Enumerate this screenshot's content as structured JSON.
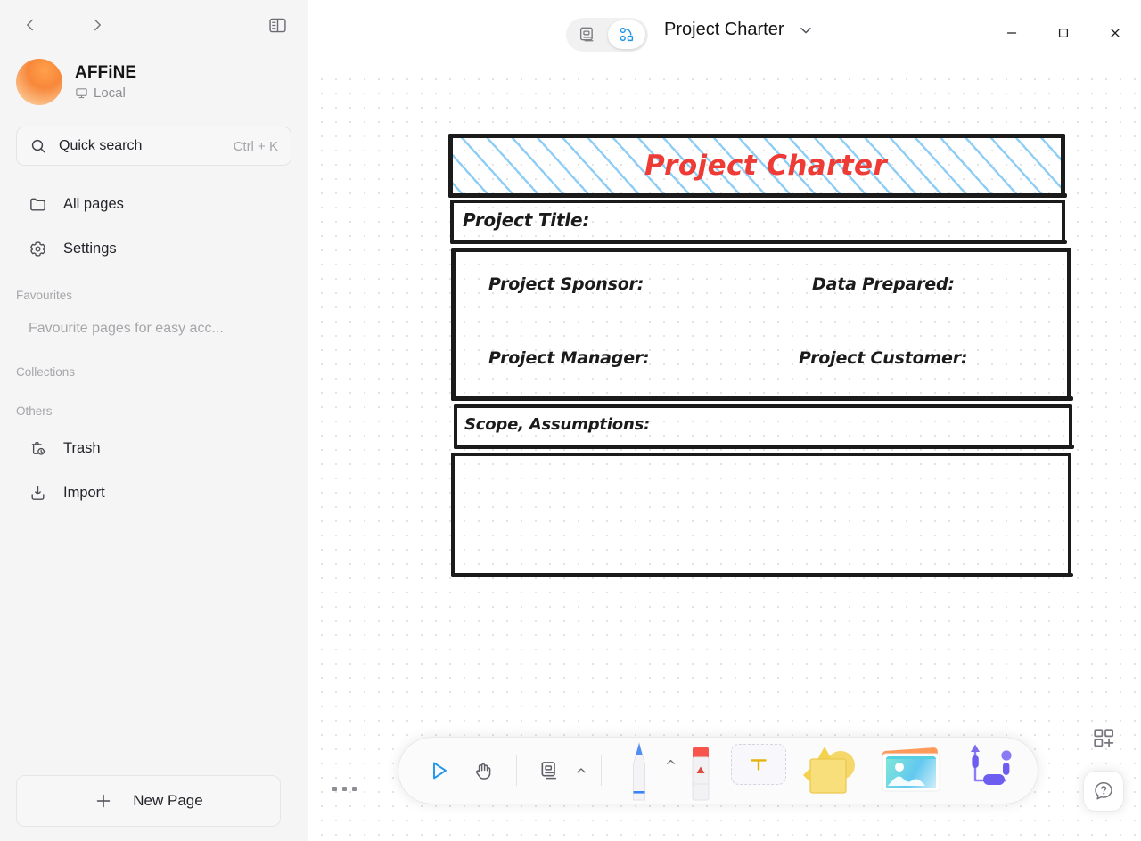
{
  "sidebar": {
    "nav": {
      "back_icon": "chevron-left-icon",
      "forward_icon": "chevron-right-icon",
      "toggle_icon": "sidebar-toggle-icon"
    },
    "workspace": {
      "name": "AFFiNE",
      "sub": "Local",
      "sub_icon": "local-desktop-icon"
    },
    "search": {
      "label": "Quick search",
      "shortcut": "Ctrl + K",
      "icon": "search-icon"
    },
    "items": [
      {
        "label": "All pages",
        "icon": "folder-icon"
      },
      {
        "label": "Settings",
        "icon": "gear-icon"
      }
    ],
    "sections": [
      {
        "label": "Favourites",
        "empty": "Favourite pages for easy acc..."
      },
      {
        "label": "Collections",
        "empty": ""
      },
      {
        "label": "Others",
        "empty": ""
      }
    ],
    "others": [
      {
        "label": "Trash",
        "icon": "trash-icon"
      },
      {
        "label": "Import",
        "icon": "import-icon"
      }
    ],
    "new_page": {
      "label": "New Page",
      "icon": "plus-icon"
    }
  },
  "header": {
    "mode": {
      "page_label": "page-mode",
      "edgeless_label": "edgeless-mode",
      "active": "edgeless"
    },
    "doc_title": "Project Charter",
    "title_chevron": "chevron-down-icon",
    "more_icon": "more-vertical-icon",
    "window": {
      "minimize": "minimize-icon",
      "maximize": "maximize-icon",
      "close": "close-icon"
    }
  },
  "canvas": {
    "handle_icon": "drag-dots-icon",
    "board": {
      "title": "Project Charter",
      "fields": [
        "Project Title:",
        "Project Sponsor:",
        "Data Prepared:",
        "Project Manager:",
        "Project Customer:",
        "Scope, Assumptions:"
      ]
    }
  },
  "toolbar": {
    "tools": [
      {
        "name": "select-tool",
        "icon": "cursor-arrow-icon"
      },
      {
        "name": "pan-tool",
        "icon": "hand-icon"
      },
      {
        "name": "note-tool",
        "icon": "note-icon"
      },
      {
        "name": "pen-tool",
        "icon": "pen-icon"
      },
      {
        "name": "eraser-tool",
        "icon": "eraser-icon"
      },
      {
        "name": "text-tool",
        "icon": "text-t-icon"
      },
      {
        "name": "shape-tool",
        "icon": "shapes-icon"
      },
      {
        "name": "image-tool",
        "icon": "image-icon"
      },
      {
        "name": "connector-tool",
        "icon": "connector-icon"
      }
    ],
    "expand_icon": "chevron-up-icon"
  },
  "fab": {
    "template_icon": "template-grid-plus-icon",
    "help_icon": "help-question-icon"
  },
  "colors": {
    "accent_blue": "#1e96eb",
    "title_red": "#ef3b35",
    "hatch_blue": "#8ecdf5",
    "sidebar_bg": "#f5f5f5",
    "stroke_black": "#1b1b1b"
  }
}
